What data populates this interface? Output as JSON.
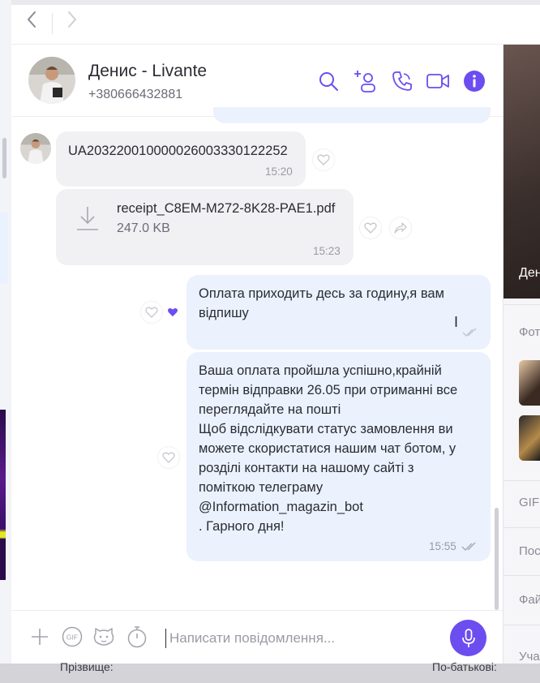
{
  "nav": {
    "back_icon": "chevron-left-icon",
    "forward_icon": "chevron-right-icon"
  },
  "chat_header": {
    "name": "Денис - Livante",
    "phone": "+380666432881",
    "actions": [
      "search-icon",
      "add-user-icon",
      "call-icon",
      "video-call-icon",
      "info-icon"
    ]
  },
  "right_panel": {
    "photo_caption": "Ден",
    "sections": [
      "Фот",
      "GIF",
      "Пос",
      "Фай",
      "Уча"
    ]
  },
  "messages": [
    {
      "direction": "in",
      "text": "UA203220010000026003330122252",
      "time": "15:20"
    },
    {
      "direction": "in",
      "type": "file",
      "filename": "receipt_C8EM-M272-8K28-PAE1.pdf",
      "size": "247.0 KB",
      "time": "15:23"
    },
    {
      "direction": "out",
      "text": "Оплата приходить десь за годину,я вам відпишу"
    },
    {
      "direction": "out",
      "lines": [
        "Ваша оплата пройшла успішно,крайній",
        "термін відправки 26.05 при отриманні все",
        "переглядайте на пошті",
        "Щоб відслідкувати статус замовлення ви",
        "можете скористатися нашим чат ботом, у",
        "розділі контакти на нашому сайті з",
        "поміткою телеграму",
        "@Information_magazin_bot",
        ". Гарного дня!"
      ],
      "time": "15:55"
    }
  ],
  "composer": {
    "placeholder": "Написати повідомлення..."
  },
  "background_form": {
    "left_label": "Прізвище:",
    "right_label": "По-батькові:"
  },
  "colors": {
    "accent": "#6c4df0",
    "outgoing_bubble": "#ebf2fd",
    "incoming_bubble": "#f1f1f3"
  }
}
